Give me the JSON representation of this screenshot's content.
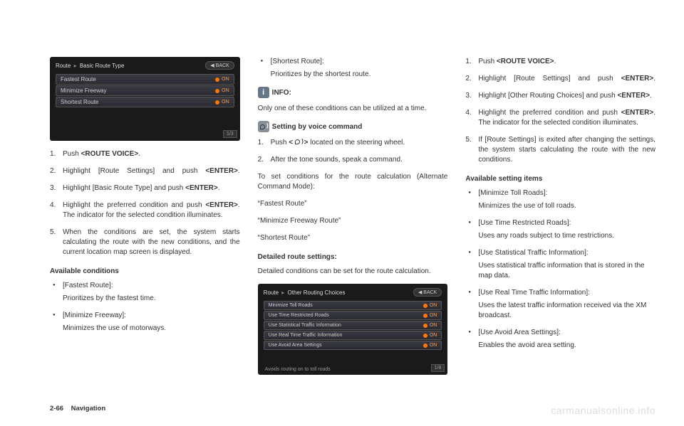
{
  "screenshot1": {
    "breadcrumb_root": "Route",
    "breadcrumb_sub": "Basic Route Type",
    "back": "BACK",
    "rows": [
      {
        "label": "Fastest Route",
        "state": "ON"
      },
      {
        "label": "Minimize Freeway",
        "state": "ON"
      },
      {
        "label": "Shortest Route",
        "state": "ON"
      }
    ],
    "pager": "1/3"
  },
  "screenshot2": {
    "breadcrumb_root": "Route",
    "breadcrumb_sub": "Other Routing Choices",
    "back": "BACK",
    "rows": [
      {
        "label": "Minimize Toll Roads",
        "state": "ON"
      },
      {
        "label": "Use Time Restricted Roads",
        "state": "ON"
      },
      {
        "label": "Use Statistical Traffic Information",
        "state": "ON"
      },
      {
        "label": "Use Real Time Traffic Information",
        "state": "ON"
      },
      {
        "label": "Use Avoid Area Settings",
        "state": "ON"
      }
    ],
    "pager": "1/8",
    "footer": "Avoids routing on to toll roads"
  },
  "col1": {
    "step1_pre": "Push ",
    "step1_bold": "<ROUTE VOICE>",
    "step1_post": ".",
    "step2_pre": "Highlight [Route Settings] and push ",
    "step2_bold": "<ENTER>",
    "step2_post": ".",
    "step3_pre": "Highlight [Basic Route Type] and push ",
    "step3_bold": "<ENTER>",
    "step3_post": ".",
    "step4_pre": "Highlight the preferred condition and push ",
    "step4_bold": "<ENTER>",
    "step4_post": ". The indicator for the selected condition illuminates.",
    "step5": "When the conditions are set, the system starts calculating the route with the new conditions, and the current location map screen is displayed.",
    "available_heading": "Available conditions",
    "bullet1_title": "[Fastest Route]:",
    "bullet1_desc": "Prioritizes by the fastest time.",
    "bullet2_title": "[Minimize Freeway]:",
    "bullet2_desc": "Minimizes the use of motorways."
  },
  "col2": {
    "bullet3_title": "[Shortest Route]:",
    "bullet3_desc": "Prioritizes by the shortest route.",
    "info_label": "INFO:",
    "info_text": "Only one of these conditions can be utilized at a time.",
    "voice_label": "Setting by voice command",
    "voice_step1_pre": "Push ",
    "voice_step1_bold": "<   >",
    "voice_step1_post": " located on the steering wheel.",
    "voice_step2": "After the tone sounds, speak a command.",
    "voice_intro": "To set conditions for the route calculation (Alternate Command Mode):",
    "cmd1": "“Fastest Route”",
    "cmd2": "“Minimize Freeway Route”",
    "cmd3": "“Shortest Route”",
    "detailed_heading": "Detailed route settings:",
    "detailed_text": "Detailed conditions can be set for the route calculation."
  },
  "col3": {
    "step1_pre": "Push ",
    "step1_bold": "<ROUTE VOICE>",
    "step1_post": ".",
    "step2_pre": "Highlight [Route Settings] and push ",
    "step2_bold": "<ENTER>",
    "step2_post": ".",
    "step3_pre": "Highlight [Other Routing Choices] and push ",
    "step3_bold": "<ENTER>",
    "step3_post": ".",
    "step4_pre": "Highlight the preferred condition and push ",
    "step4_bold": "<ENTER>",
    "step4_post": ". The indicator for the selected condition illuminates.",
    "step5": "If [Route Settings] is exited after changing the settings, the system starts calculating the route with the new conditions.",
    "available_heading": "Available setting items",
    "bullet1_title": "[Minimize Toll Roads]:",
    "bullet1_desc": "Minimizes the use of toll roads.",
    "bullet2_title": "[Use Time Restricted Roads]:",
    "bullet2_desc": "Uses any roads subject to time restrictions.",
    "bullet3_title": "[Use Statistical Traffic Information]:",
    "bullet3_desc": "Uses statistical traffic information that is stored in the map data.",
    "bullet4_title": "[Use Real Time Traffic Information]:",
    "bullet4_desc": "Uses the latest traffic information received via the XM broadcast.",
    "bullet5_title": "[Use Avoid Area Settings]:",
    "bullet5_desc": "Enables the avoid area setting."
  },
  "footer": {
    "page": "2-66",
    "section": "Navigation",
    "watermark": "carmanualsonline.info"
  }
}
